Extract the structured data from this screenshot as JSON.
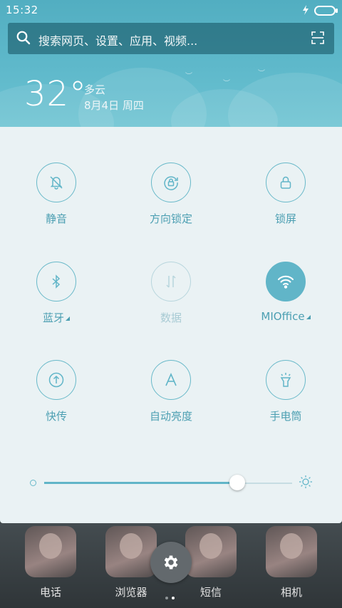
{
  "status_bar": {
    "time": "15:32",
    "charging": true
  },
  "search": {
    "placeholder": "搜索网页、设置、应用、视频..."
  },
  "weather": {
    "temperature": "32°",
    "condition": "多云",
    "date": "8月4日 周四"
  },
  "toggles": [
    {
      "label": "静音",
      "icon": "bell-off-icon",
      "state": "off"
    },
    {
      "label": "方向锁定",
      "icon": "rotation-lock-icon",
      "state": "off"
    },
    {
      "label": "锁屏",
      "icon": "lock-icon",
      "state": "off"
    },
    {
      "label": "蓝牙",
      "icon": "bluetooth-icon",
      "state": "off",
      "has_submenu": true
    },
    {
      "label": "数据",
      "icon": "mobile-data-icon",
      "state": "disabled"
    },
    {
      "label": "MIOffice",
      "icon": "wifi-icon",
      "state": "on",
      "has_submenu": true
    },
    {
      "label": "快传",
      "icon": "share-transfer-icon",
      "state": "off"
    },
    {
      "label": "自动亮度",
      "icon": "auto-brightness-icon",
      "state": "off"
    },
    {
      "label": "手电筒",
      "icon": "flashlight-icon",
      "state": "off"
    }
  ],
  "brightness": {
    "level": 0.78
  },
  "dock": [
    {
      "label": "电话"
    },
    {
      "label": "浏览器"
    },
    {
      "label": "短信"
    },
    {
      "label": "相机"
    }
  ],
  "pager": {
    "pages": 2,
    "current": 1
  },
  "colors": {
    "accent": "#61b5c8",
    "label": "#4c9fb2",
    "header": "#5fb9cb",
    "panel": "#eaf2f4"
  }
}
